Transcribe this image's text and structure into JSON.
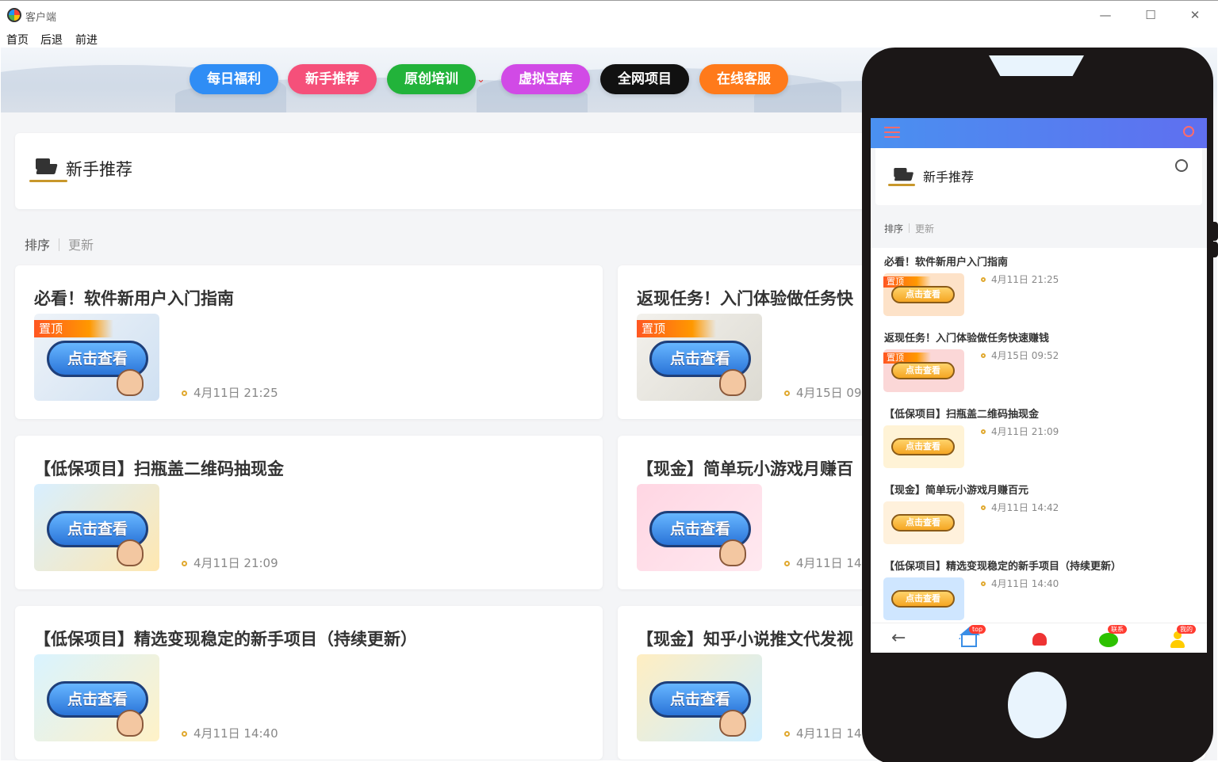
{
  "window": {
    "title": "客户端",
    "controls": {
      "minimize": "—",
      "maximize": "☐",
      "close": "✕"
    }
  },
  "menu": [
    "首页",
    "后退",
    "前进"
  ],
  "nav": [
    {
      "label": "每日福利",
      "color": "#2f8df5"
    },
    {
      "label": "新手推荐",
      "color": "#f5507a"
    },
    {
      "label": "原创培训",
      "color": "#22b33a"
    },
    {
      "label": "虚拟宝库",
      "color": "#d14ae6"
    },
    {
      "label": "全网项目",
      "color": "#111111"
    },
    {
      "label": "在线客服",
      "color": "#ff7a1a"
    }
  ],
  "nav_caret": "⌄",
  "header": {
    "title": "新手推荐"
  },
  "sort": {
    "sort_label": "排序",
    "update_label": "更新"
  },
  "thumb": {
    "button_text": "点击查看",
    "pin_label": "置顶"
  },
  "posts": [
    {
      "title": "必看！软件新用户入门指南",
      "time": "4月11日 21:25",
      "pinned": true
    },
    {
      "title": "返现任务！入门体验做任务快",
      "time": "4月15日 09:",
      "pinned": true
    },
    {
      "title": "【低保项目】扫瓶盖二维码抽现金",
      "time": "4月11日 21:09",
      "pinned": false
    },
    {
      "title": "【现金】简单玩小游戏月赚百",
      "time": "4月11日 14:",
      "pinned": false
    },
    {
      "title": "【低保项目】精选变现稳定的新手项目（持续更新）",
      "time": "4月11日 14:40",
      "pinned": false
    },
    {
      "title": "【现金】知乎小说推文代发视",
      "time": "4月11日 14:",
      "pinned": false
    }
  ],
  "phone": {
    "header_title": "新手推荐",
    "sort_label": "排序",
    "update_label": "更新",
    "items": [
      {
        "title": "必看！软件新用户入门指南",
        "time": "4月11日 21:25",
        "pinned": true
      },
      {
        "title": "返现任务！入门体验做任务快速赚钱",
        "time": "4月15日 09:52",
        "pinned": true
      },
      {
        "title": "【低保项目】扫瓶盖二维码抽现金",
        "time": "4月11日 21:09",
        "pinned": false
      },
      {
        "title": "【现金】简单玩小游戏月赚百元",
        "time": "4月11日 14:42",
        "pinned": false
      },
      {
        "title": "【低保项目】精选变现稳定的新手项目（持续更新）",
        "time": "4月11日 14:40",
        "pinned": false
      }
    ],
    "bottom": {
      "back": "←",
      "home_badge": "top",
      "chat_badge": "联系",
      "me_badge": "我的"
    }
  }
}
